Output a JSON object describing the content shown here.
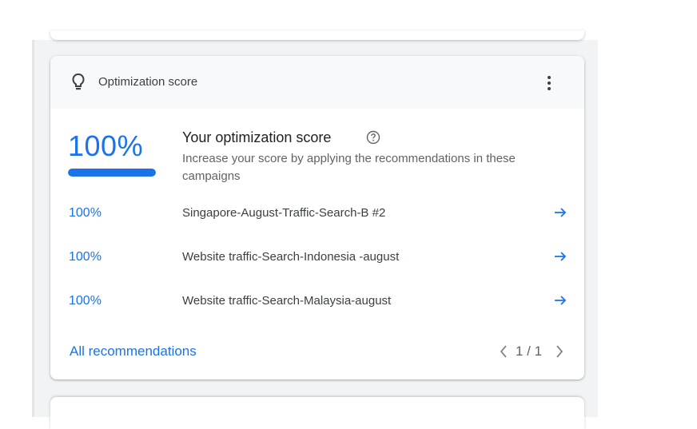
{
  "card": {
    "header_title": "Optimization score",
    "header_icon": "lightbulb-icon",
    "menu_icon": "more-vert-icon"
  },
  "score": {
    "value_text": "100%",
    "progress": 1.0,
    "title": "Your optimization score",
    "description": "Increase your score by applying the recommendations in these campaigns",
    "help_icon": "help-circle-icon"
  },
  "campaigns": [
    {
      "score": "100%",
      "name": "Singapore-August-Traffic-Search-B #2"
    },
    {
      "score": "100%",
      "name": "Website traffic-Search-Indonesia -august"
    },
    {
      "score": "100%",
      "name": "Website traffic-Search-Malaysia-august"
    }
  ],
  "footer": {
    "all_recommendations": "All recommendations",
    "pagination": "1 / 1"
  },
  "colors": {
    "accent": "#1a73e8",
    "text": "#202124",
    "secondary_text": "#5f6368",
    "background": "#f1f3f4"
  }
}
